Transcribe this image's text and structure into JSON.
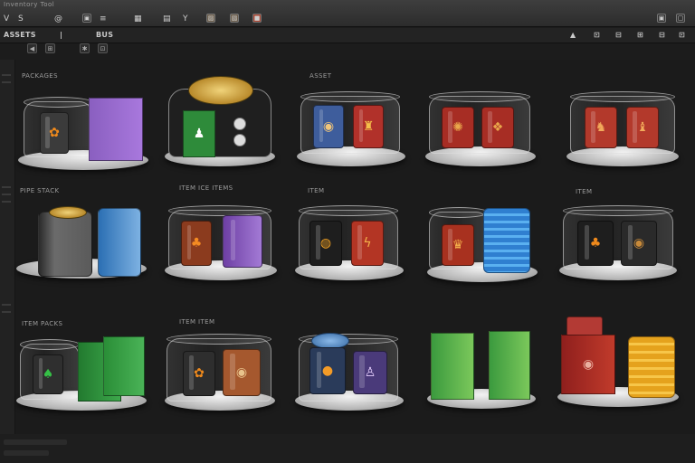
{
  "window": {
    "title": "Inventory Tool"
  },
  "toolbar": {
    "buttons": [
      {
        "label": "V",
        "icon": "cursor-icon"
      },
      {
        "label": "S",
        "icon": "select-icon"
      },
      {
        "label": "@",
        "icon": "lasso-icon"
      },
      {
        "label": "▣",
        "icon": "layer-icon"
      },
      {
        "label": "≡",
        "icon": "list-icon"
      },
      {
        "label": "▦",
        "icon": "grid-icon"
      },
      {
        "label": "▤",
        "icon": "table-icon"
      },
      {
        "label": "Y",
        "icon": "filter-icon"
      },
      {
        "label": "▨",
        "icon": "image-icon"
      },
      {
        "label": "▧",
        "icon": "photo-icon"
      },
      {
        "label": "■",
        "icon": "color-swatch-icon"
      }
    ],
    "right_buttons": [
      {
        "label": "▣"
      },
      {
        "label": "▢"
      }
    ]
  },
  "secondbar": {
    "section_label": "ASSETS",
    "sep": "|",
    "tab_label": "BUS"
  },
  "secondbar_buttons": [
    "◀",
    "⊞",
    "✱",
    "⊡"
  ],
  "right_controls": [
    "▲",
    "⊡",
    "⊟",
    "⊞",
    "⊟",
    "⊡"
  ],
  "grid": {
    "rows": [
      {
        "label": "PACKAGES",
        "items": [
          {
            "name": "orange-purple-cans"
          },
          {
            "name": "coin-dice-box",
            "sub": ""
          },
          {
            "name": "blue-red-jars",
            "sub": "ASSET"
          },
          {
            "name": "red-canisters"
          },
          {
            "name": "red-canisters-2"
          }
        ]
      },
      {
        "label": "PIPE STACK",
        "items": [
          {
            "name": "gray-blue-boxes"
          },
          {
            "name": "orange-purple-jars",
            "sub": "ITEM ICE ITEMS"
          },
          {
            "name": "black-red-jars",
            "sub": "ITEM"
          },
          {
            "name": "red-blue-cylinders"
          },
          {
            "name": "orange-brown-jars",
            "sub": "ITEM"
          }
        ]
      },
      {
        "label": "ITEM PACKS",
        "items": [
          {
            "name": "green-boxes"
          },
          {
            "name": "orange-brown-cans",
            "sub": "ITEM ITEM"
          },
          {
            "name": "blue-purple-cans"
          },
          {
            "name": "green-cards"
          },
          {
            "name": "red-crate-coins"
          }
        ]
      }
    ]
  },
  "colors": {
    "background": "#1b1b1b",
    "toolbar": "#333333",
    "accent_red": "#a9432f"
  }
}
